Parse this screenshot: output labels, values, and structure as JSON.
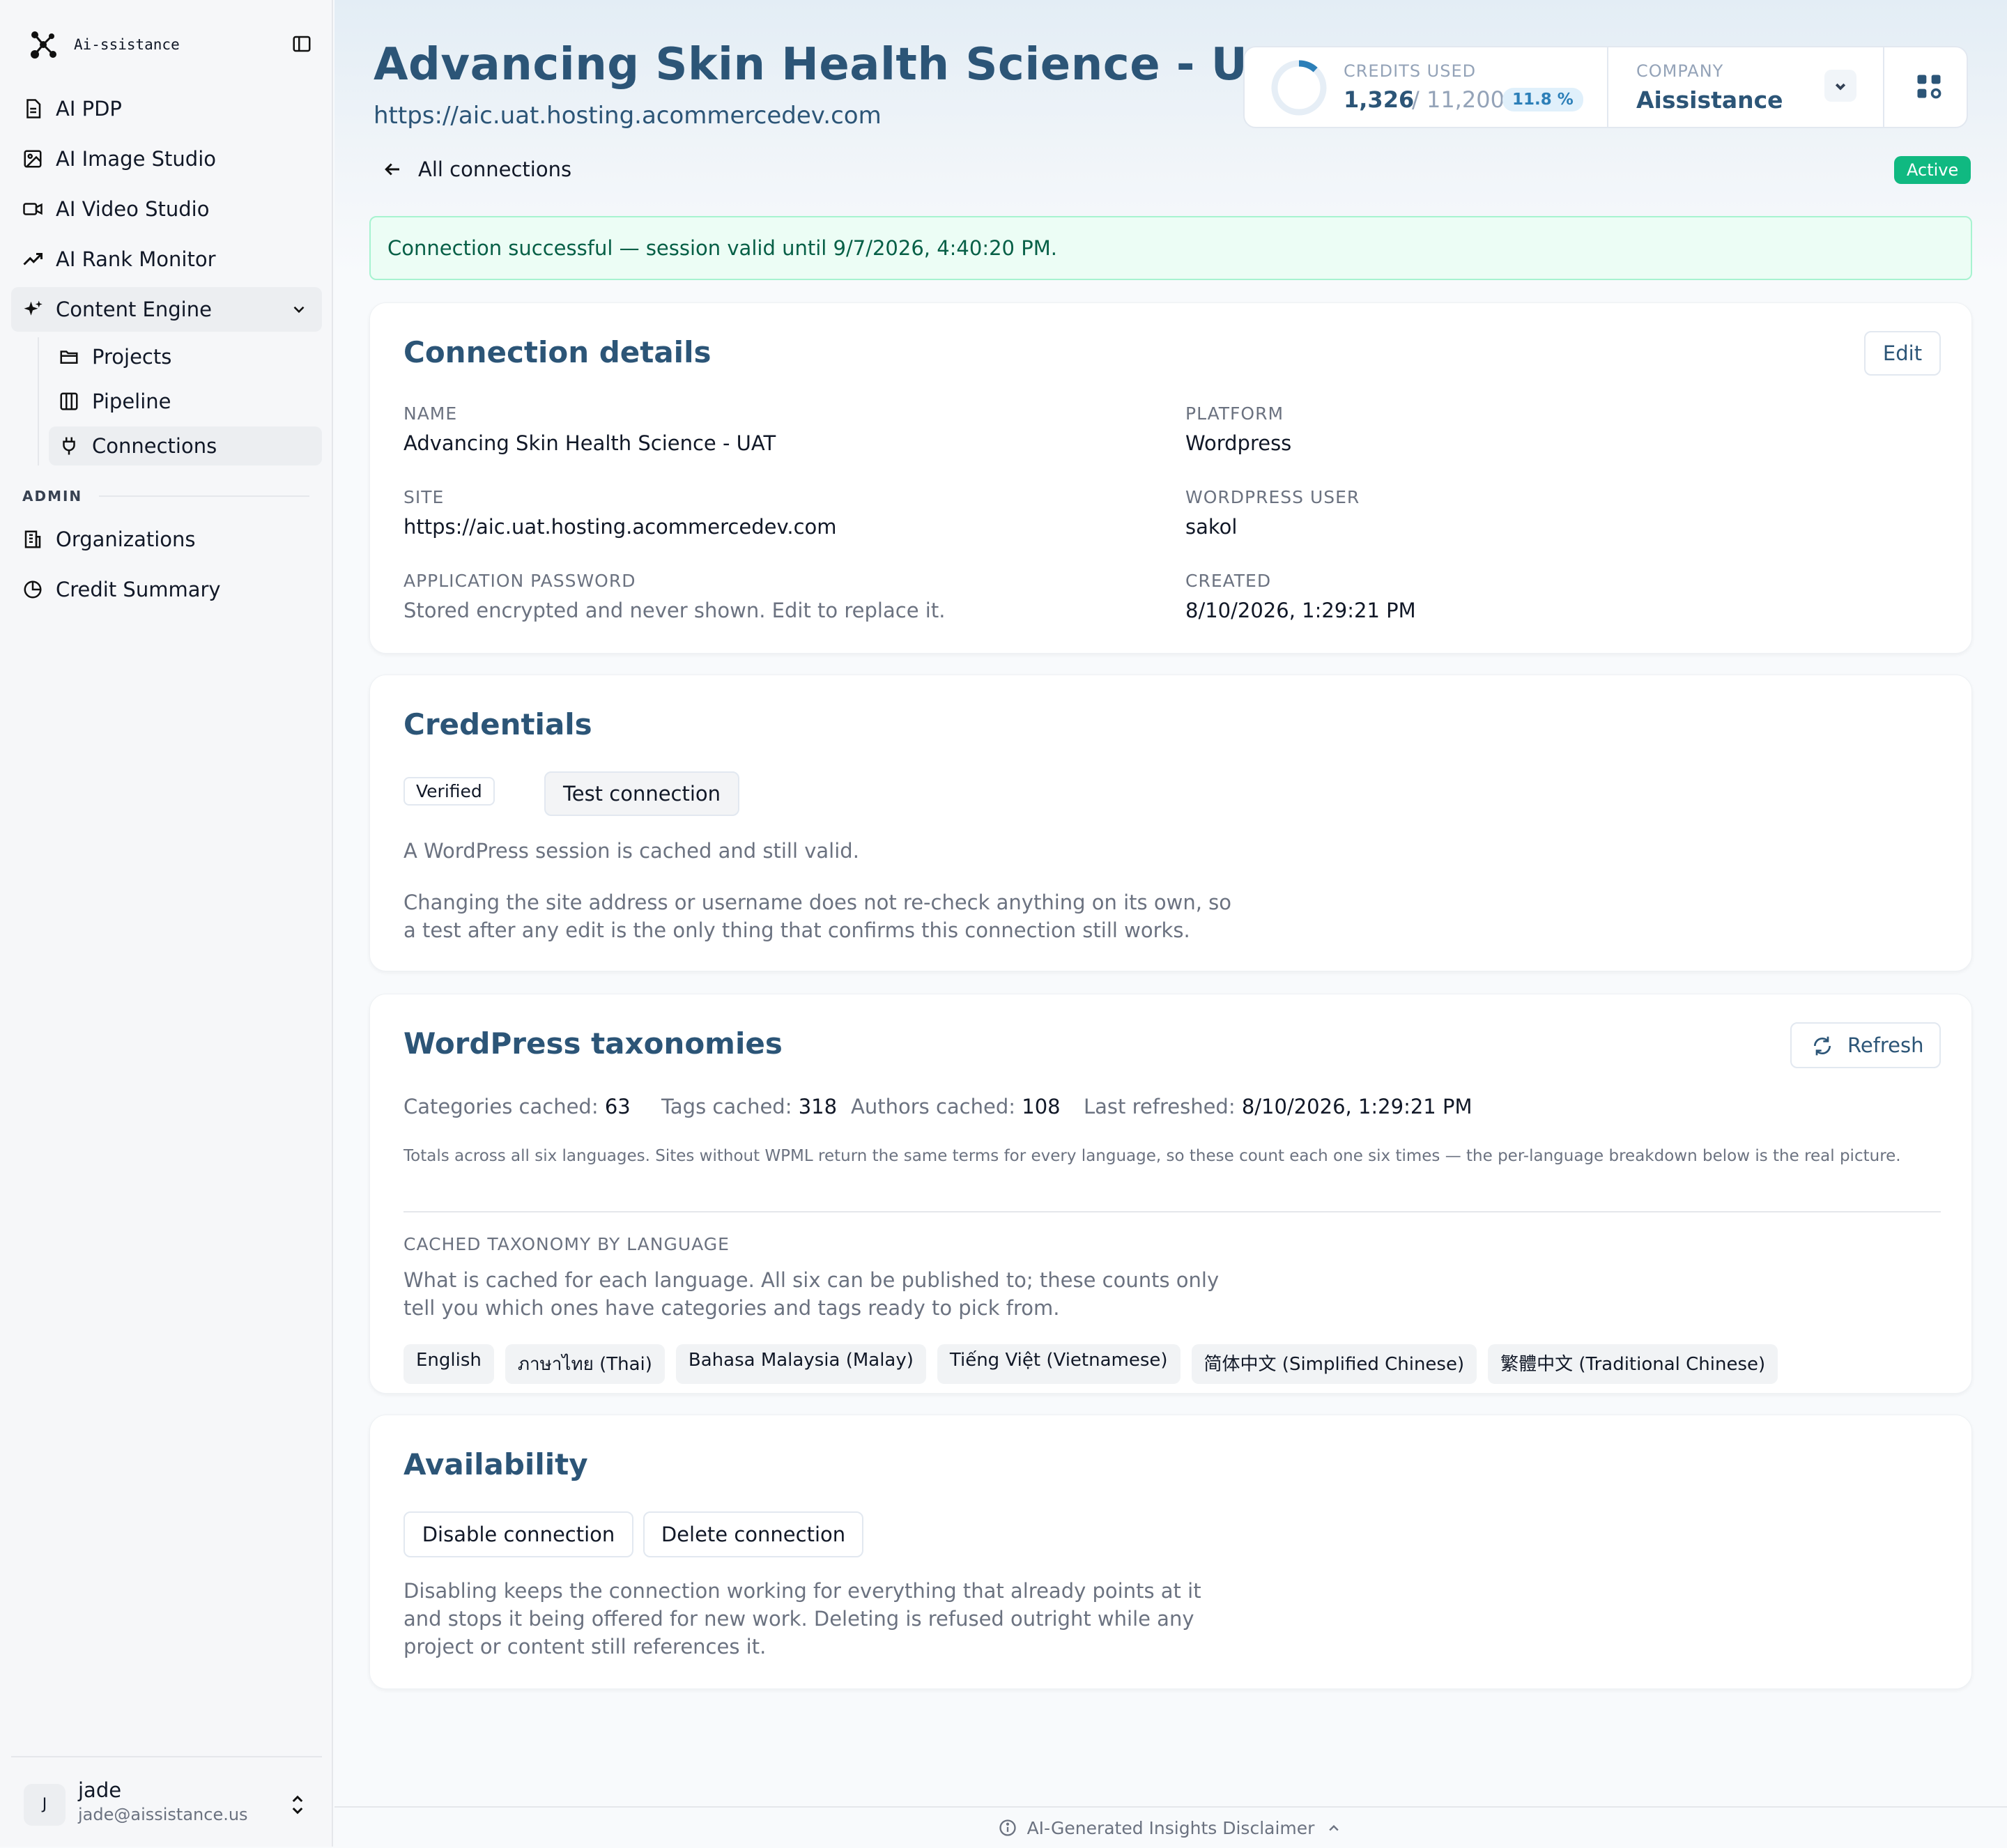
{
  "app": {
    "name": "Ai-ssistance"
  },
  "sidebar": {
    "items": [
      {
        "label": "AI PDP",
        "icon": "document-icon"
      },
      {
        "label": "AI Image Studio",
        "icon": "image-icon"
      },
      {
        "label": "AI Video Studio",
        "icon": "video-icon"
      },
      {
        "label": "AI Rank Monitor",
        "icon": "trending-up-icon"
      }
    ],
    "content_engine": {
      "label": "Content Engine",
      "icon": "sparkles-icon",
      "children": [
        {
          "label": "Projects",
          "icon": "folder-icon"
        },
        {
          "label": "Pipeline",
          "icon": "columns-icon"
        },
        {
          "label": "Connections",
          "icon": "plug-icon"
        }
      ]
    },
    "admin_label": "ADMIN",
    "admin_items": [
      {
        "label": "Organizations",
        "icon": "building-icon"
      },
      {
        "label": "Credit Summary",
        "icon": "pie-chart-icon"
      }
    ],
    "user": {
      "initial": "J",
      "name": "jade",
      "email": "jade@aissistance.us"
    }
  },
  "header": {
    "title": "Advancing Skin Health Science - UAT",
    "url": "https://aic.uat.hosting.acommercedev.com",
    "credits": {
      "label": "CREDITS USED",
      "used": "1,326",
      "total": "/ 11,200",
      "percent_label": "11.8 %",
      "percent_value": 0.118
    },
    "company": {
      "label": "COMPANY",
      "name": "Aissistance"
    }
  },
  "nav": {
    "back_label": "All connections",
    "status": "Active"
  },
  "colors": {
    "accent": "#2c5577",
    "success": "#10b981",
    "success_bg": "#ecfdf5"
  },
  "alert": "Connection successful — session valid until 9/7/2026, 4:40:20 PM.",
  "details": {
    "title": "Connection details",
    "edit_label": "Edit",
    "name_label": "NAME",
    "name_value": "Advancing Skin Health Science - UAT",
    "platform_label": "PLATFORM",
    "platform_value": "Wordpress",
    "site_label": "SITE",
    "site_value": "https://aic.uat.hosting.acommercedev.com",
    "wp_user_label": "WORDPRESS USER",
    "wp_user_value": "sakol",
    "password_label": "APPLICATION PASSWORD",
    "password_value": "Stored encrypted and never shown. Edit to replace it.",
    "created_label": "CREATED",
    "created_value": "8/10/2026, 1:29:21 PM"
  },
  "credentials": {
    "title": "Credentials",
    "badge": "Verified",
    "test_label": "Test connection",
    "text1": "A WordPress session is cached and still valid.",
    "text2": "Changing the site address or username does not re-check anything on its own, so a test after any edit is the only thing that confirms this connection still works."
  },
  "taxonomies": {
    "title": "WordPress taxonomies",
    "refresh_label": "Refresh",
    "categories_label": "Categories cached:",
    "categories_value": "63",
    "tags_label": "Tags cached:",
    "tags_value": "318",
    "authors_label": "Authors cached:",
    "authors_value": "108",
    "refreshed_label": "Last refreshed:",
    "refreshed_value": "8/10/2026, 1:29:21 PM",
    "note": "Totals across all six languages. Sites without WPML return the same terms for every language, so these count each one six times — the per-language breakdown below is the real picture.",
    "by_language_label": "CACHED TAXONOMY BY LANGUAGE",
    "by_language_text": "What is cached for each language. All six can be published to; these counts only tell you which ones have categories and tags ready to pick from.",
    "languages": [
      "English",
      "ภาษาไทย (Thai)",
      "Bahasa Malaysia (Malay)",
      "Tiếng Việt (Vietnamese)",
      "简体中文 (Simplified Chinese)",
      "繁體中文 (Traditional Chinese)"
    ]
  },
  "availability": {
    "title": "Availability",
    "disable_label": "Disable connection",
    "delete_label": "Delete connection",
    "text": "Disabling keeps the connection working for everything that already points at it and stops it being offered for new work. Deleting is refused outright while any project or content still references it."
  },
  "footer": {
    "label": "AI-Generated Insights Disclaimer"
  }
}
